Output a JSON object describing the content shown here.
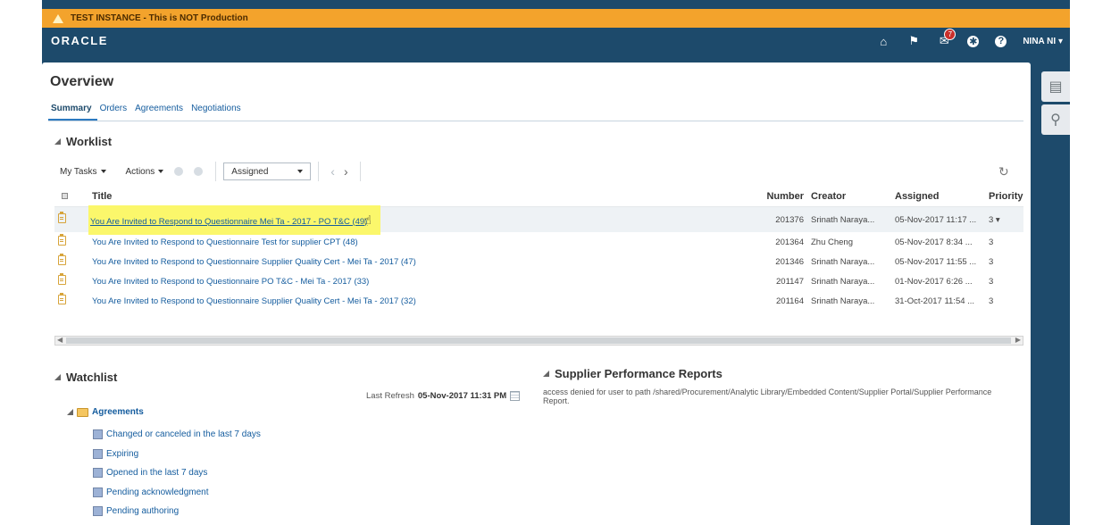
{
  "banner": {
    "text": "TEST INSTANCE - This is NOT Production"
  },
  "header": {
    "brand": "ORACLE",
    "notification_count": "7",
    "user": "NINA NI"
  },
  "page": {
    "title": "Overview",
    "tabs": [
      "Summary",
      "Orders",
      "Agreements",
      "Negotiations"
    ]
  },
  "worklist": {
    "title": "Worklist",
    "my_tasks": "My Tasks",
    "actions": "Actions",
    "filter_value": "Assigned",
    "columns": {
      "title": "Title",
      "number": "Number",
      "creator": "Creator",
      "assigned": "Assigned",
      "priority": "Priority"
    },
    "rows": [
      {
        "title": "You Are Invited to Respond to Questionnaire Mei Ta - 2017 - PO T&C (49)",
        "number": "201376",
        "creator": "Srinath Naraya...",
        "assigned": "05-Nov-2017 11:17 ...",
        "priority": "3"
      },
      {
        "title": "You Are Invited to Respond to Questionnaire Test for supplier CPT (48)",
        "number": "201364",
        "creator": "Zhu Cheng",
        "assigned": "05-Nov-2017 8:34 ...",
        "priority": "3"
      },
      {
        "title": "You Are Invited to Respond to Questionnaire Supplier Quality Cert - Mei Ta - 2017 (47)",
        "number": "201346",
        "creator": "Srinath Naraya...",
        "assigned": "05-Nov-2017 11:55 ...",
        "priority": "3"
      },
      {
        "title": "You Are Invited to Respond to Questionnaire PO T&C - Mei Ta - 2017 (33)",
        "number": "201147",
        "creator": "Srinath Naraya...",
        "assigned": "01-Nov-2017 6:26 ...",
        "priority": "3"
      },
      {
        "title": "You Are Invited to Respond to Questionnaire Supplier Quality Cert - Mei Ta - 2017 (32)",
        "number": "201164",
        "creator": "Srinath Naraya...",
        "assigned": "31-Oct-2017 11:54 ...",
        "priority": "3"
      }
    ]
  },
  "watchlist": {
    "title": "Watchlist",
    "last_refresh_label": "Last Refresh",
    "last_refresh_value": "05-Nov-2017 11:31 PM",
    "folder": "Agreements",
    "items": [
      "Changed or canceled in the last 7 days",
      "Expiring",
      "Opened in the last 7 days",
      "Pending acknowledgment",
      "Pending authoring"
    ]
  },
  "reports": {
    "title": "Supplier Performance Reports",
    "message": "access denied for user to path /shared/Procurement/Analytic Library/Embedded Content/Supplier Portal/Supplier Performance Report."
  }
}
